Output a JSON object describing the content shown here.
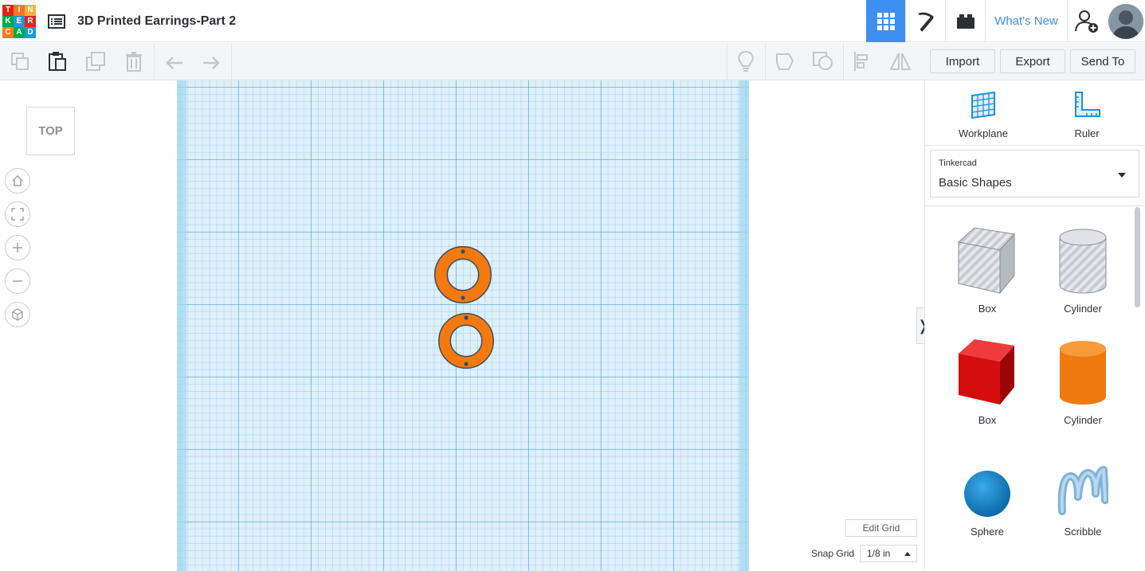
{
  "header": {
    "logo_letters": [
      "T",
      "I",
      "N",
      "K",
      "E",
      "R",
      "C",
      "A",
      "D"
    ],
    "logo_colors": [
      "#e2231a",
      "#f47920",
      "#fbb034",
      "#00a94f",
      "#1e9ad6",
      "#e2231a",
      "#f47920",
      "#00a94f",
      "#1e9ad6"
    ],
    "doc_title": "3D Printed Earrings-Part 2",
    "whats_new_label": "What's New",
    "icons": [
      "list-icon",
      "grid-view-icon",
      "pickaxe-icon",
      "brick-icon",
      "add-user-icon",
      "avatar"
    ]
  },
  "toolbar": {
    "left_icons": [
      "copy-icon",
      "paste-icon",
      "duplicate-icon",
      "delete-icon",
      "undo-icon",
      "redo-icon"
    ],
    "right_icons": [
      "lightbulb-icon",
      "shape-outline-icon",
      "group-icon",
      "align-icon",
      "mirror-icon"
    ],
    "import_label": "Import",
    "export_label": "Export",
    "send_to_label": "Send To"
  },
  "workspace": {
    "viewcube_label": "TOP",
    "nav_icons": [
      "home-icon",
      "fit-view-icon",
      "zoom-in-icon",
      "zoom-out-icon",
      "perspective-icon"
    ],
    "edit_grid_label": "Edit Grid",
    "snap_grid_label": "Snap Grid",
    "snap_grid_value": "1/8 in",
    "colors": {
      "grid_bg": "#dff0fa",
      "object": "#f47a10"
    }
  },
  "panel": {
    "workplane_label": "Workplane",
    "ruler_label": "Ruler",
    "library_category": "Tinkercad",
    "library_name": "Basic Shapes",
    "shapes": [
      {
        "label": "Box"
      },
      {
        "label": "Cylinder"
      },
      {
        "label": "Box"
      },
      {
        "label": "Cylinder"
      },
      {
        "label": "Sphere"
      },
      {
        "label": "Scribble"
      }
    ]
  }
}
